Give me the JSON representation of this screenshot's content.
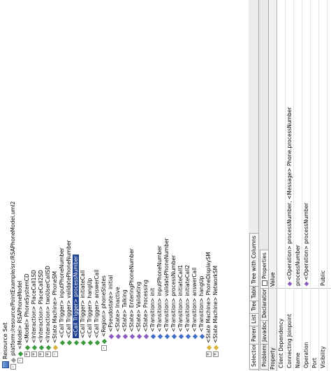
{
  "resource_set": {
    "title": "Resource Set",
    "tree": [
      {
        "label": "platform:/resource/PointExample/src/RSAPhoneModel.uml2",
        "depth": 0,
        "color": "gray",
        "expander": "-"
      },
      {
        "label": "<Model> RSAPhoneModel",
        "depth": 1,
        "color": "green",
        "expander": "-"
      },
      {
        "label": "<Model> PhoneSystemCD",
        "depth": 2,
        "color": "green",
        "expander": "+"
      },
      {
        "label": "<Interaction> PlaceCall1SD",
        "depth": 2,
        "color": "green",
        "expander": "+"
      },
      {
        "label": "<Interaction> PlaceCall2SD",
        "depth": 2,
        "color": "green",
        "expander": "+"
      },
      {
        "label": "<Interaction> twoUserCallSD",
        "depth": 2,
        "color": "green",
        "expander": "+"
      },
      {
        "label": "<State Machine> PhoneSM",
        "depth": 2,
        "color": "yellow",
        "expander": "-"
      },
      {
        "label": "<Call Trigger> inputPhoneNumber",
        "depth": 3,
        "color": "green",
        "expander": ""
      },
      {
        "label": "<Call Trigger> validatePhoneNumber",
        "depth": 3,
        "color": "green",
        "expander": ""
      },
      {
        "label": "<Call Trigger> processNumber",
        "depth": 3,
        "color": "green",
        "expander": "",
        "selected": true
      },
      {
        "label": "<Call Trigger> initiateCall",
        "depth": 3,
        "color": "green",
        "expander": ""
      },
      {
        "label": "<Call Trigger> hangUp",
        "depth": 3,
        "color": "green",
        "expander": ""
      },
      {
        "label": "<Call Trigger> answerCall",
        "depth": 3,
        "color": "green",
        "expander": ""
      },
      {
        "label": "<Region> phoneStates",
        "depth": 3,
        "color": "green",
        "expander": "-"
      },
      {
        "label": "<Pseudostate> initial",
        "depth": 4,
        "color": "purple",
        "expander": ""
      },
      {
        "label": "<State> Inactive",
        "depth": 4,
        "color": "purple",
        "expander": ""
      },
      {
        "label": "<State> Talking",
        "depth": 4,
        "color": "purple",
        "expander": ""
      },
      {
        "label": "<State> EnteringPhoneNumber",
        "depth": 4,
        "color": "purple",
        "expander": ""
      },
      {
        "label": "<State> Validating",
        "depth": 4,
        "color": "purple",
        "expander": ""
      },
      {
        "label": "<State> Processing",
        "depth": 4,
        "color": "purple",
        "expander": ""
      },
      {
        "label": "<Transition> init",
        "depth": 4,
        "color": "blue",
        "expander": ""
      },
      {
        "label": "<Transition> inputPhoneNumber",
        "depth": 4,
        "color": "blue",
        "expander": ""
      },
      {
        "label": "<Transition> validatePhoneNumber",
        "depth": 4,
        "color": "blue",
        "expander": ""
      },
      {
        "label": "<Transition> processNumber",
        "depth": 4,
        "color": "blue",
        "expander": ""
      },
      {
        "label": "<Transition> initiateCall1",
        "depth": 4,
        "color": "blue",
        "expander": ""
      },
      {
        "label": "<Transition> initiateCall2",
        "depth": 4,
        "color": "blue",
        "expander": ""
      },
      {
        "label": "<Transition> answerCall",
        "depth": 4,
        "color": "blue",
        "expander": ""
      },
      {
        "label": "<Transition> hangUp",
        "depth": 4,
        "color": "blue",
        "expander": ""
      },
      {
        "label": "<State Machine> PhoneDisplaySM",
        "depth": 2,
        "color": "yellow",
        "expander": "+"
      },
      {
        "label": "<State Machine> NetworkSM",
        "depth": 2,
        "color": "yellow",
        "expander": "+"
      }
    ]
  },
  "view_tabs": [
    "Selection",
    "Parent",
    "List",
    "Tree",
    "Table",
    "Tree with Columns"
  ],
  "bottom_tabs": [
    "Problems",
    "Javadoc",
    "Declaration",
    "Properties"
  ],
  "properties": {
    "header_property": "Property",
    "header_value": "Value",
    "rows": [
      {
        "property": "Client Dependency",
        "value": "",
        "icon": ""
      },
      {
        "property": "Connecting Joinpoint",
        "value": "<Operation> processNumber, <Message> Phone.processNumber",
        "icon": "op"
      },
      {
        "property": "Name",
        "value": "processNumber",
        "icon": "grid"
      },
      {
        "property": "Operation",
        "value": "<Operation> processNumber",
        "icon": "op"
      },
      {
        "property": "Port",
        "value": "",
        "icon": ""
      },
      {
        "property": "Visibility",
        "value": "Public",
        "icon": "grid"
      }
    ]
  }
}
